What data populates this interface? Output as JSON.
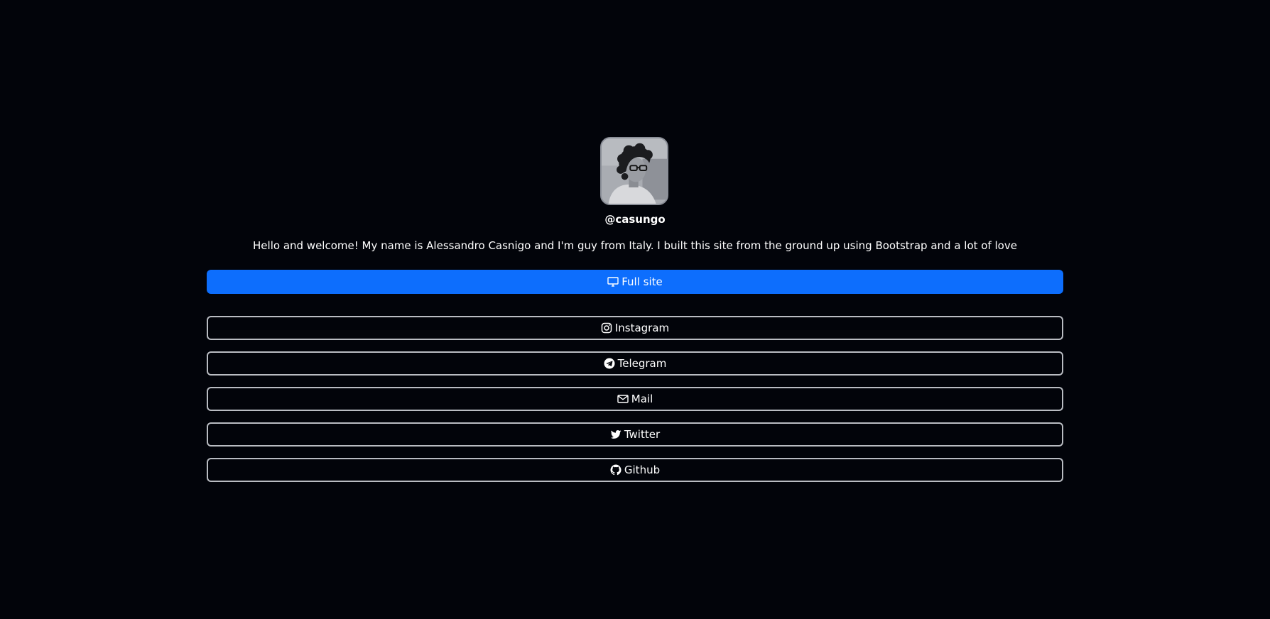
{
  "profile": {
    "handle": "@casungo",
    "bio": "Hello and welcome! My name is Alessandro Casnigo and I'm guy from Italy. I built this site from the ground up using Bootstrap and a lot of love",
    "avatar_icon": "profile-photo"
  },
  "primary_link": {
    "label": "Full site",
    "icon": "monitor-icon",
    "color": "#0d6efd"
  },
  "links": [
    {
      "label": "Instagram",
      "icon": "instagram-icon"
    },
    {
      "label": "Telegram",
      "icon": "telegram-icon"
    },
    {
      "label": "Mail",
      "icon": "envelope-icon"
    },
    {
      "label": "Twitter",
      "icon": "twitter-icon"
    },
    {
      "label": "Github",
      "icon": "github-icon"
    }
  ],
  "colors": {
    "background": "#02040a",
    "outline": "#b9bcc2",
    "text": "#ffffff"
  }
}
